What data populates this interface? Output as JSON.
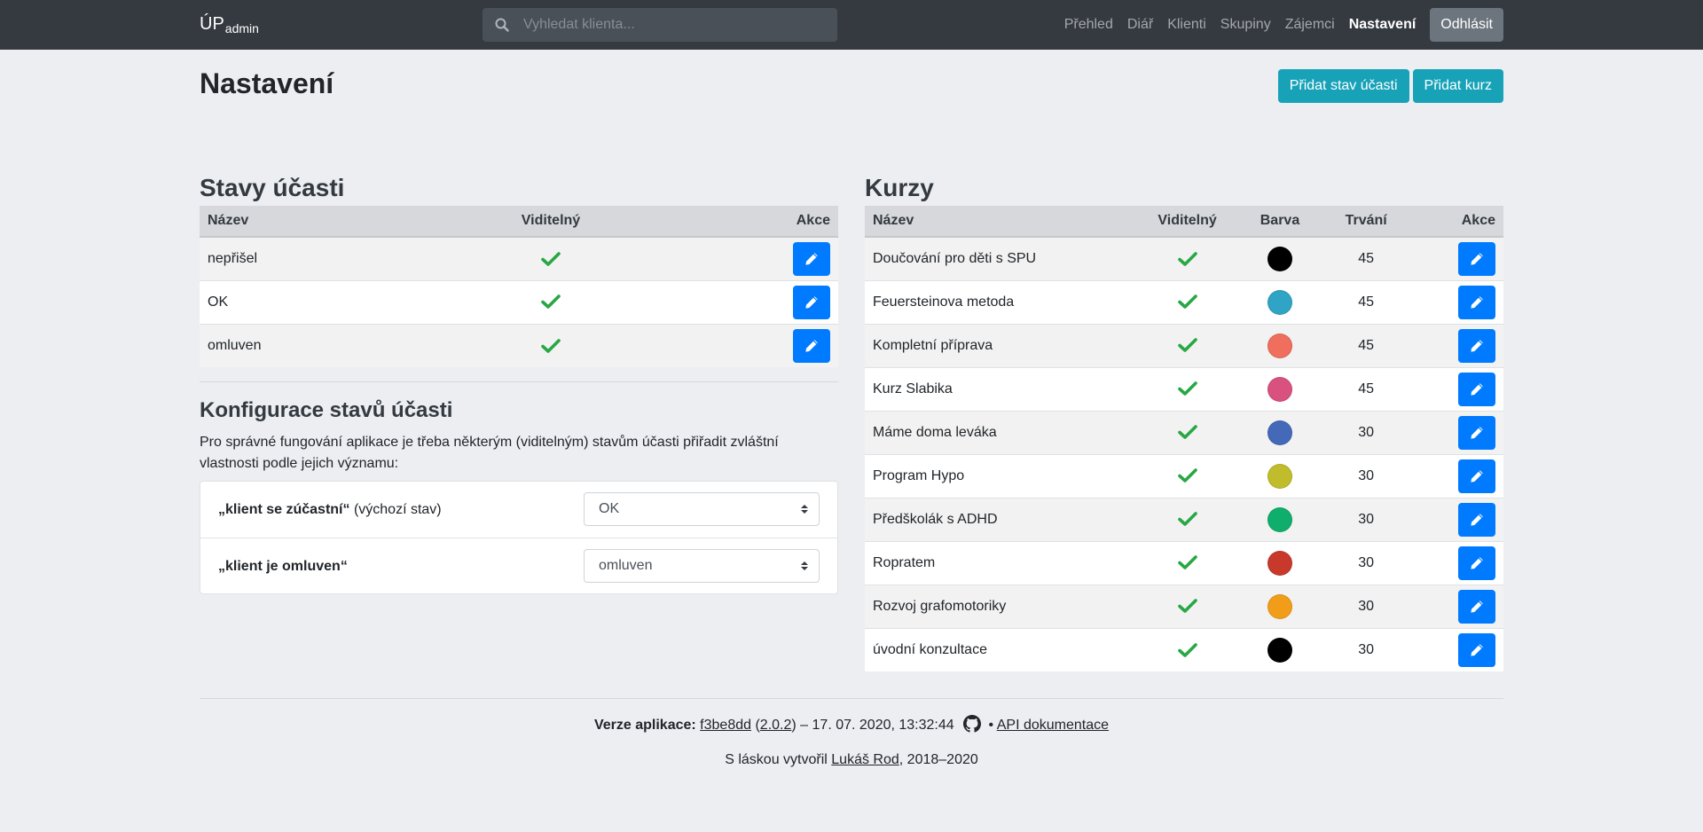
{
  "navbar": {
    "brand_main": "ÚP",
    "brand_sub": "admin",
    "search_placeholder": "Vyhledat klienta...",
    "links": [
      "Přehled",
      "Diář",
      "Klienti",
      "Skupiny",
      "Zájemci",
      "Nastavení"
    ],
    "active_link": "Nastavení",
    "logout_label": "Odhlásit"
  },
  "page": {
    "title": "Nastavení",
    "add_status_button": "Přidat stav účasti",
    "add_course_button": "Přidat kurz"
  },
  "statuses": {
    "heading": "Stavy účasti",
    "columns": [
      "Název",
      "Viditelný",
      "Akce"
    ],
    "rows": [
      {
        "name": "nepřišel",
        "visible": true
      },
      {
        "name": "OK",
        "visible": true
      },
      {
        "name": "omluven",
        "visible": true
      }
    ]
  },
  "config": {
    "heading": "Konfigurace stavů účasti",
    "description": "Pro správné fungování aplikace je třeba některým (viditelným) stavům účasti přiřadit zvláštní vlastnosti podle jejich významu:",
    "rows": [
      {
        "label_bold": "„klient se zúčastní“",
        "label_extra": " (výchozí stav)",
        "selected": "OK"
      },
      {
        "label_bold": "„klient je omluven“",
        "label_extra": "",
        "selected": "omluven"
      }
    ]
  },
  "courses": {
    "heading": "Kurzy",
    "columns": [
      "Název",
      "Viditelný",
      "Barva",
      "Trvání",
      "Akce"
    ],
    "rows": [
      {
        "name": "Doučování pro děti s SPU",
        "visible": true,
        "color": "#000000",
        "duration": "45"
      },
      {
        "name": "Feuersteinova metoda",
        "visible": true,
        "color": "#2fa4c4",
        "duration": "45"
      },
      {
        "name": "Kompletní příprava",
        "visible": true,
        "color": "#ef6e5d",
        "duration": "45"
      },
      {
        "name": "Kurz Slabika",
        "visible": true,
        "color": "#d8517f",
        "duration": "45"
      },
      {
        "name": "Máme doma leváka",
        "visible": true,
        "color": "#4469b8",
        "duration": "30"
      },
      {
        "name": "Program Hypo",
        "visible": true,
        "color": "#c1bc2c",
        "duration": "30"
      },
      {
        "name": "Předškolák s ADHD",
        "visible": true,
        "color": "#0fae6c",
        "duration": "30"
      },
      {
        "name": "Ropratem",
        "visible": true,
        "color": "#c8392c",
        "duration": "30"
      },
      {
        "name": "Rozvoj grafomotoriky",
        "visible": true,
        "color": "#f29d1a",
        "duration": "30"
      },
      {
        "name": "úvodní konzultace",
        "visible": true,
        "color": "#000000",
        "duration": "30"
      }
    ]
  },
  "footer": {
    "version_label": "Verze aplikace:",
    "commit": "f3be8dd",
    "version": "2.0.2",
    "date": "17. 07. 2020, 13:32:44",
    "api_link": "API dokumentace",
    "credit_prefix": "S láskou vytvořil",
    "author": "Lukáš Rod",
    "years": ", 2018–2020"
  },
  "colors": {
    "navbar_bg": "#343a40",
    "primary": "#007bff",
    "info": "#17a2b8",
    "success": "#28a745",
    "secondary": "#6c757d"
  }
}
